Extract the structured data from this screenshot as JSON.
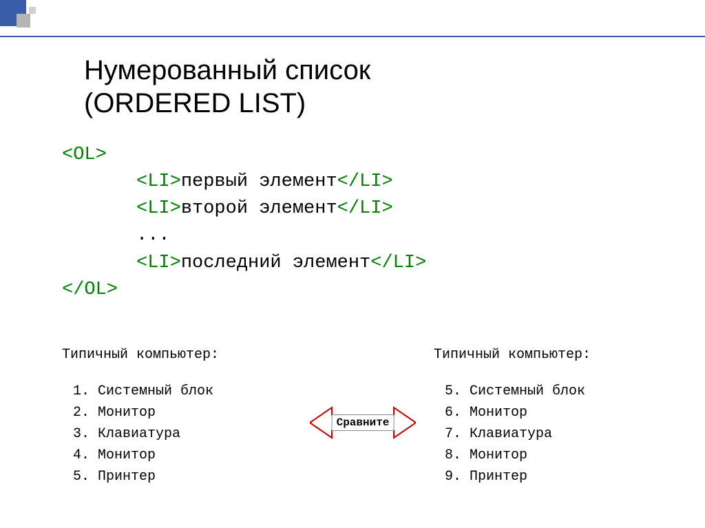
{
  "title_line1": "Нумерованный список",
  "title_line2": "(ORDERED LIST)",
  "code": {
    "open": "<OL>",
    "li_open": "<LI>",
    "li_close": "</LI>",
    "item1": "первый элемент",
    "item2": "второй элемент",
    "dots": "...",
    "item_last": "последний элемент",
    "close": "</OL>"
  },
  "example_left": {
    "header": "Типичный компьютер:",
    "items": [
      "1. Системный блок",
      "2. Монитор",
      "3. Клавиатура",
      "4. Монитор",
      "5. Принтер"
    ]
  },
  "example_right": {
    "header": "Типичный компьютер:",
    "items": [
      "5. Системный блок",
      "6. Монитор",
      "7. Клавиатура",
      "8. Монитор",
      "9. Принтер"
    ]
  },
  "compare_label": "Сравните"
}
